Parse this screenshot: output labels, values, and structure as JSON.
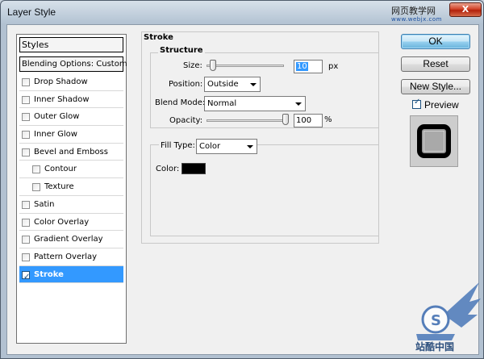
{
  "window": {
    "title": "Layer Style",
    "watermark_cn": "网页教学网",
    "watermark_url": "www.webjx.com",
    "close_symbol": "X"
  },
  "styles_panel": {
    "header": "Styles",
    "blending_options": "Blending Options: Custom",
    "items": [
      {
        "label": "Drop Shadow",
        "checked": false,
        "indent": false
      },
      {
        "label": "Inner Shadow",
        "checked": false,
        "indent": false
      },
      {
        "label": "Outer Glow",
        "checked": false,
        "indent": false
      },
      {
        "label": "Inner Glow",
        "checked": false,
        "indent": false
      },
      {
        "label": "Bevel and Emboss",
        "checked": false,
        "indent": false
      },
      {
        "label": "Contour",
        "checked": false,
        "indent": true
      },
      {
        "label": "Texture",
        "checked": false,
        "indent": true
      },
      {
        "label": "Satin",
        "checked": false,
        "indent": false
      },
      {
        "label": "Color Overlay",
        "checked": false,
        "indent": false
      },
      {
        "label": "Gradient Overlay",
        "checked": false,
        "indent": false
      },
      {
        "label": "Pattern Overlay",
        "checked": false,
        "indent": false
      },
      {
        "label": "Stroke",
        "checked": true,
        "indent": false,
        "selected": true
      }
    ]
  },
  "stroke": {
    "group_title": "Stroke",
    "structure_title": "Structure",
    "size_label": "Size:",
    "size_value": "10",
    "size_unit": "px",
    "size_slider_fraction": 0.04,
    "position_label": "Position:",
    "position_value": "Outside",
    "blend_mode_label": "Blend Mode:",
    "blend_mode_value": "Normal",
    "opacity_label": "Opacity:",
    "opacity_value": "100",
    "opacity_unit": "%",
    "opacity_slider_fraction": 1.0,
    "fill_type_label": "Fill Type:",
    "fill_type_value": "Color",
    "color_label": "Color:",
    "color_value": "#000000"
  },
  "buttons": {
    "ok": "OK",
    "reset": "Reset",
    "new_style": "New Style...",
    "preview_label": "Preview",
    "preview_checked": true
  },
  "watermark_bottom": "站酷中国"
}
